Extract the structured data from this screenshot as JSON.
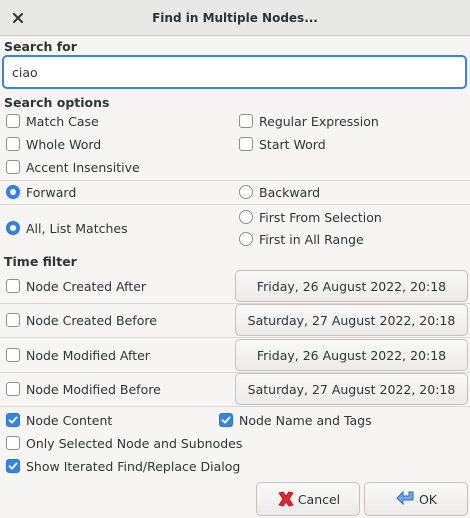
{
  "window": {
    "title": "Find in Multiple Nodes...",
    "close_icon": "close-icon"
  },
  "search": {
    "section_label": "Search for",
    "value": "ciao"
  },
  "options": {
    "section_label": "Search options",
    "match_case": {
      "label": "Match Case",
      "checked": false
    },
    "regular_expression": {
      "label": "Regular Expression",
      "checked": false
    },
    "whole_word": {
      "label": "Whole Word",
      "checked": false
    },
    "start_word": {
      "label": "Start Word",
      "checked": false
    },
    "accent_insensitive": {
      "label": "Accent Insensitive",
      "checked": false
    },
    "forward": {
      "label": "Forward",
      "selected": true
    },
    "backward": {
      "label": "Backward",
      "selected": false
    },
    "all_list_matches": {
      "label": "All, List Matches",
      "selected": true
    },
    "first_from_selection": {
      "label": "First From Selection",
      "selected": false
    },
    "first_in_all_range": {
      "label": "First in All Range",
      "selected": false
    }
  },
  "time_filter": {
    "section_label": "Time filter",
    "created_after": {
      "label": "Node Created After",
      "checked": false,
      "date": "Friday, 26 August 2022, 20:18"
    },
    "created_before": {
      "label": "Node Created Before",
      "checked": false,
      "date": "Saturday, 27 August 2022, 20:18"
    },
    "modified_after": {
      "label": "Node Modified After",
      "checked": false,
      "date": "Friday, 26 August 2022, 20:18"
    },
    "modified_before": {
      "label": "Node Modified Before",
      "checked": false,
      "date": "Saturday, 27 August 2022, 20:18"
    }
  },
  "scope": {
    "node_content": {
      "label": "Node Content",
      "checked": true
    },
    "node_name_tags": {
      "label": "Node Name and Tags",
      "checked": true
    },
    "only_selected": {
      "label": "Only Selected Node and Subnodes",
      "checked": false
    },
    "show_iterated": {
      "label": "Show Iterated Find/Replace Dialog",
      "checked": true
    }
  },
  "buttons": {
    "cancel_label": "Cancel",
    "ok_label": "OK"
  },
  "colors": {
    "accent": "#3584e4",
    "cancel_icon": "#e0282e",
    "ok_icon": "#4a90d9"
  }
}
